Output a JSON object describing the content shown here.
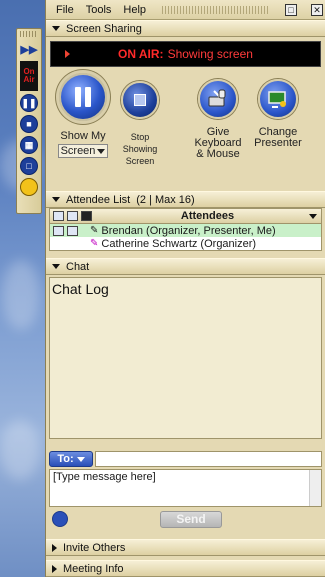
{
  "menu": {
    "file": "File",
    "tools": "Tools",
    "help": "Help"
  },
  "screen_sharing": {
    "section_title": "Screen Sharing",
    "on_air_label": "ON AIR:",
    "on_air_status": "Showing screen",
    "tools": {
      "show_my": "Show My",
      "screen_dropdown": "Screen",
      "stop_line1": "Stop",
      "stop_line2": "Showing",
      "stop_line3": "Screen",
      "give_line1": "Give",
      "give_line2": "Keyboard",
      "give_line3": "& Mouse",
      "change_line1": "Change",
      "change_line2": "Presenter"
    }
  },
  "attendee_list": {
    "section_title": "Attendee List",
    "count_text": "(2 | Max 16)",
    "column_header": "Attendees",
    "rows": [
      {
        "name": "Brendan (Organizer, Presenter, Me)"
      },
      {
        "name": "Catherine Schwartz (Organizer)"
      }
    ]
  },
  "chat": {
    "section_title": "Chat",
    "log_label": "Chat Log",
    "to_label": "To:",
    "message_placeholder": "[Type message here]",
    "send_label": "Send"
  },
  "collapsed_sections": {
    "invite_others": "Invite Others",
    "meeting_info": "Meeting Info"
  },
  "left_toolbar": {
    "on_air_line1": "On",
    "on_air_line2": "Air"
  },
  "colors": {
    "panel_bg": "#e4d9b3",
    "accent_blue": "#2a55c9",
    "on_air_red": "#ff2a2a",
    "selected_row": "#c9f0c9"
  }
}
